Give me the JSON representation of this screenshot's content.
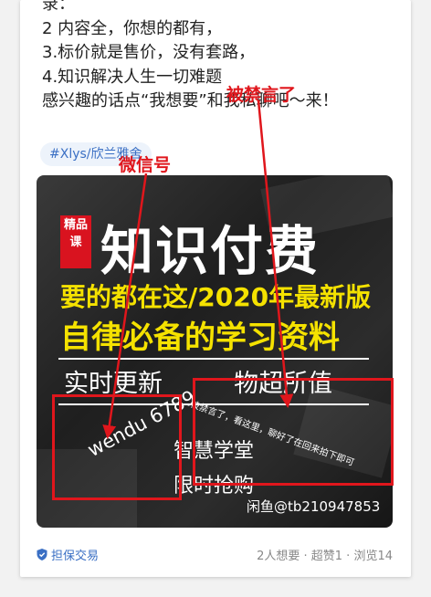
{
  "post": {
    "lines": [
      "录：",
      "2 内容全，你想的都有，",
      "3.标价就是售价，没有套路，",
      "4.知识解决人生一切难题",
      "感兴趣的话点“我想要”和我私聊吧～来！"
    ],
    "tag": "#Xlys/欣兰雅舍"
  },
  "image": {
    "badge": "精品课",
    "title": "知识付费",
    "subtitle1": "要的都在这/2020年最新版",
    "subtitle2": "自律必备的学习资料",
    "left_slogan": "实时更新",
    "right_slogan": "物超所值",
    "handwritten": "wendu 6789",
    "line_a": "智慧学堂",
    "line_b": "限时抢购",
    "note": "被禁言了，看这里，聊好了在回来拍下即可",
    "watermark": "闲鱼@tb210947853"
  },
  "annotations": {
    "label_banned": "被禁言了",
    "label_wechat": "微信号",
    "color": "#e0161c"
  },
  "footer": {
    "guarantee": "担保交易",
    "stats": "2人想要 · 超赞1 · 浏览14"
  },
  "colors": {
    "accent_blue": "#3a6fc4",
    "highlight_yellow": "#f5e200",
    "badge_red": "#d9131f"
  }
}
